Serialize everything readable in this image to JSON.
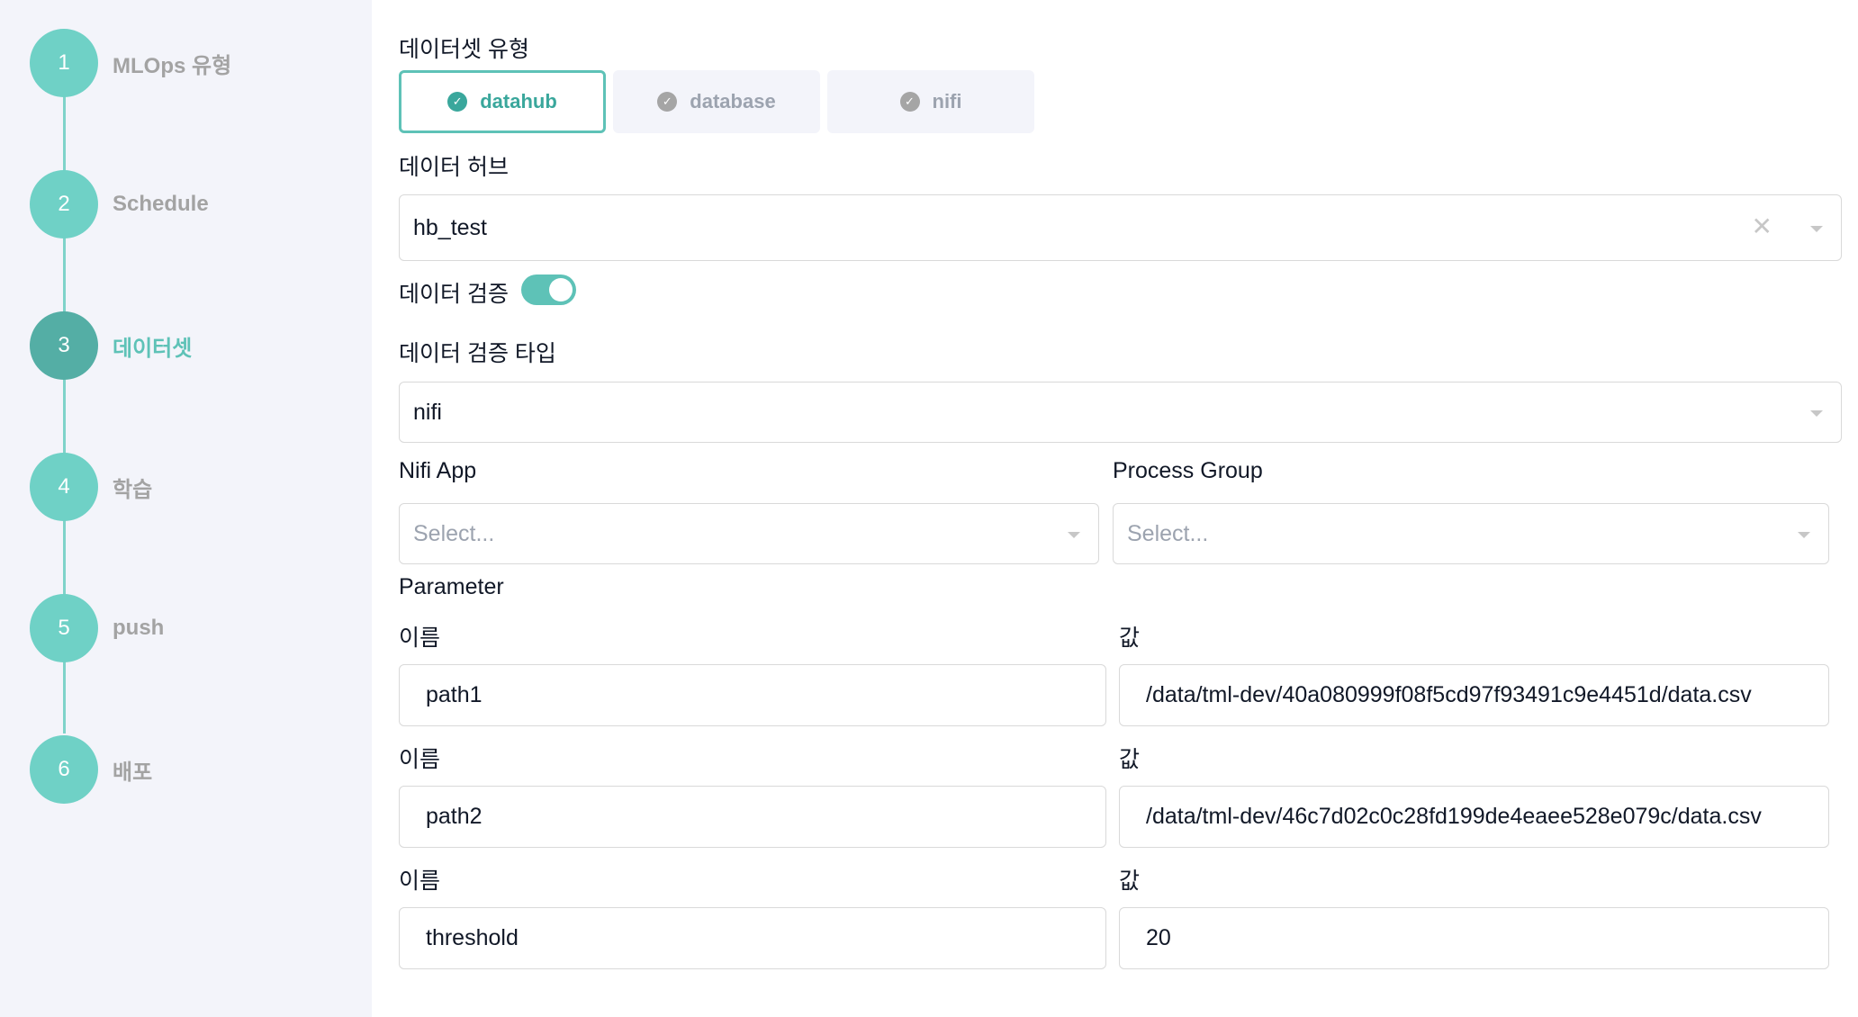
{
  "stepper": {
    "steps": [
      {
        "number": "1",
        "label": "MLOps 유형"
      },
      {
        "number": "2",
        "label": "Schedule"
      },
      {
        "number": "3",
        "label": "데이터셋"
      },
      {
        "number": "4",
        "label": "학습"
      },
      {
        "number": "5",
        "label": "push"
      },
      {
        "number": "6",
        "label": "배포"
      }
    ],
    "active_step": "3"
  },
  "dataset_type": {
    "label": "데이터셋 유형",
    "options": [
      "datahub",
      "database",
      "nifi"
    ],
    "selected": "datahub"
  },
  "data_hub": {
    "label": "데이터 허브",
    "value": "hb_test"
  },
  "data_validation": {
    "label": "데이터 검증",
    "enabled": true
  },
  "validation_type": {
    "label": "데이터 검증 타입",
    "value": "nifi"
  },
  "nifi_app": {
    "label": "Nifi App",
    "placeholder": "Select..."
  },
  "process_group": {
    "label": "Process Group",
    "placeholder": "Select..."
  },
  "parameter": {
    "label": "Parameter",
    "name_label": "이름",
    "value_label": "값",
    "rows": [
      {
        "name": "path1",
        "value": "/data/tml-dev/40a080999f08f5cd97f93491c9e4451d/data.csv"
      },
      {
        "name": "path2",
        "value": "/data/tml-dev/46c7d02c0c28fd199de4eaee528e079c/data.csv"
      },
      {
        "name": "threshold",
        "value": "20"
      }
    ]
  },
  "colors": {
    "accent": "#5ec2b7",
    "accent_dark": "#3aa79c",
    "step_circle": "#6fd1c6",
    "step_active": "#54aea5",
    "sidebar_bg": "#f3f4fa"
  }
}
